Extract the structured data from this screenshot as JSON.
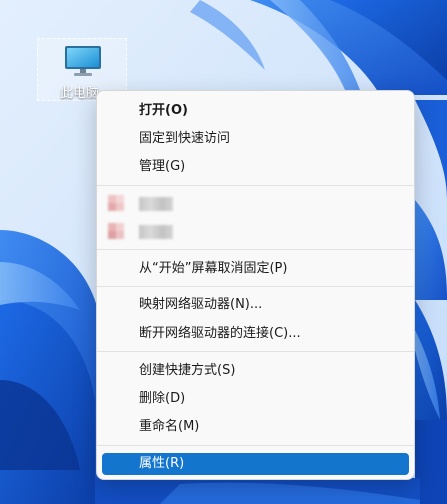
{
  "desktop": {
    "icon_label": "此电脑",
    "icon": "monitor-icon"
  },
  "context_menu": {
    "groups": [
      {
        "items": [
          {
            "label": "打开(O)",
            "bold": true
          },
          {
            "label": "固定到快速访问"
          },
          {
            "label": "管理(G)"
          }
        ]
      },
      {
        "items": [
          {
            "label": "",
            "obscured": true
          },
          {
            "label": "",
            "obscured": true
          }
        ]
      },
      {
        "items": [
          {
            "label": "从“开始”屏幕取消固定(P)"
          }
        ]
      },
      {
        "items": [
          {
            "label": "映射网络驱动器(N)..."
          },
          {
            "label": "断开网络驱动器的连接(C)..."
          }
        ]
      },
      {
        "items": [
          {
            "label": "创建快捷方式(S)"
          },
          {
            "label": "删除(D)"
          },
          {
            "label": "重命名(M)"
          }
        ]
      },
      {
        "items": [
          {
            "label": "属性(R)",
            "highlighted": true
          }
        ]
      }
    ]
  },
  "colors": {
    "highlight": "#1475cf",
    "menu_background": "#f9f9f9",
    "wallpaper_primary": "#1b5fd6",
    "wallpaper_light": "#cfe3fb"
  }
}
